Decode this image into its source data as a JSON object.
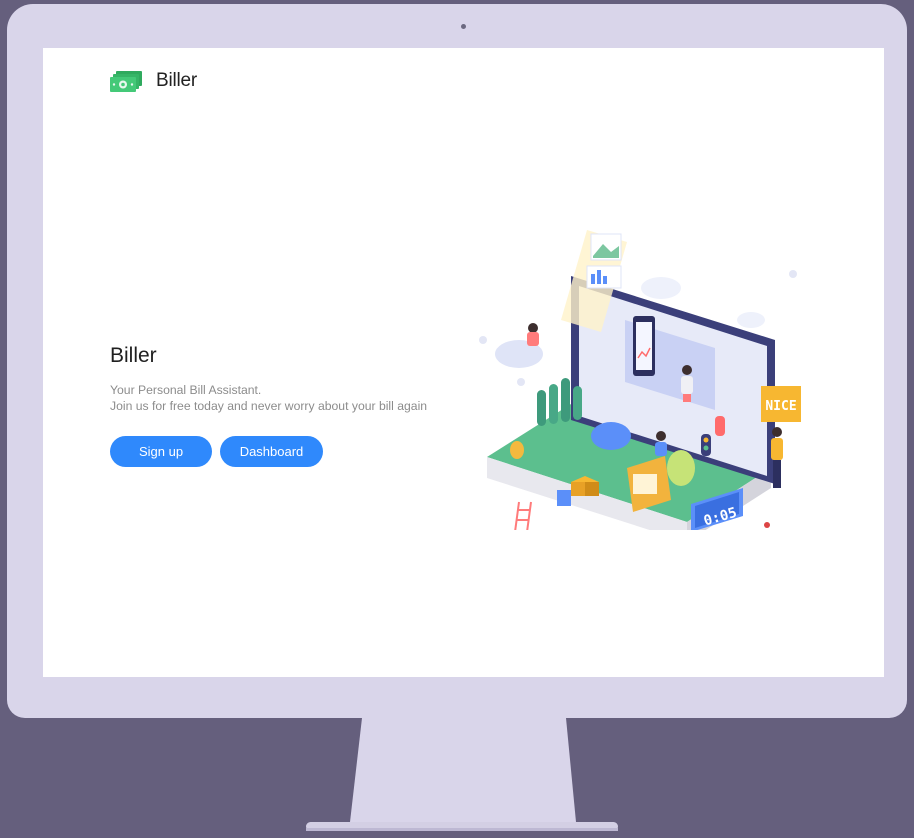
{
  "brand": {
    "name": "Biller",
    "icon": "money-bills-icon"
  },
  "hero": {
    "title": "Biller",
    "tagline": "Your Personal Bill Assistant.",
    "description": "Join us for free today and never worry about your bill again",
    "signup_label": "Sign up",
    "dashboard_label": "Dashboard"
  },
  "illustration": {
    "timer_text": "0:05",
    "badge_text": "NICE"
  },
  "colors": {
    "backdrop": "#655f7d",
    "monitor_frame": "#d9d5ea",
    "accent": "#2f89fc",
    "brand_green": "#3dbf74"
  }
}
